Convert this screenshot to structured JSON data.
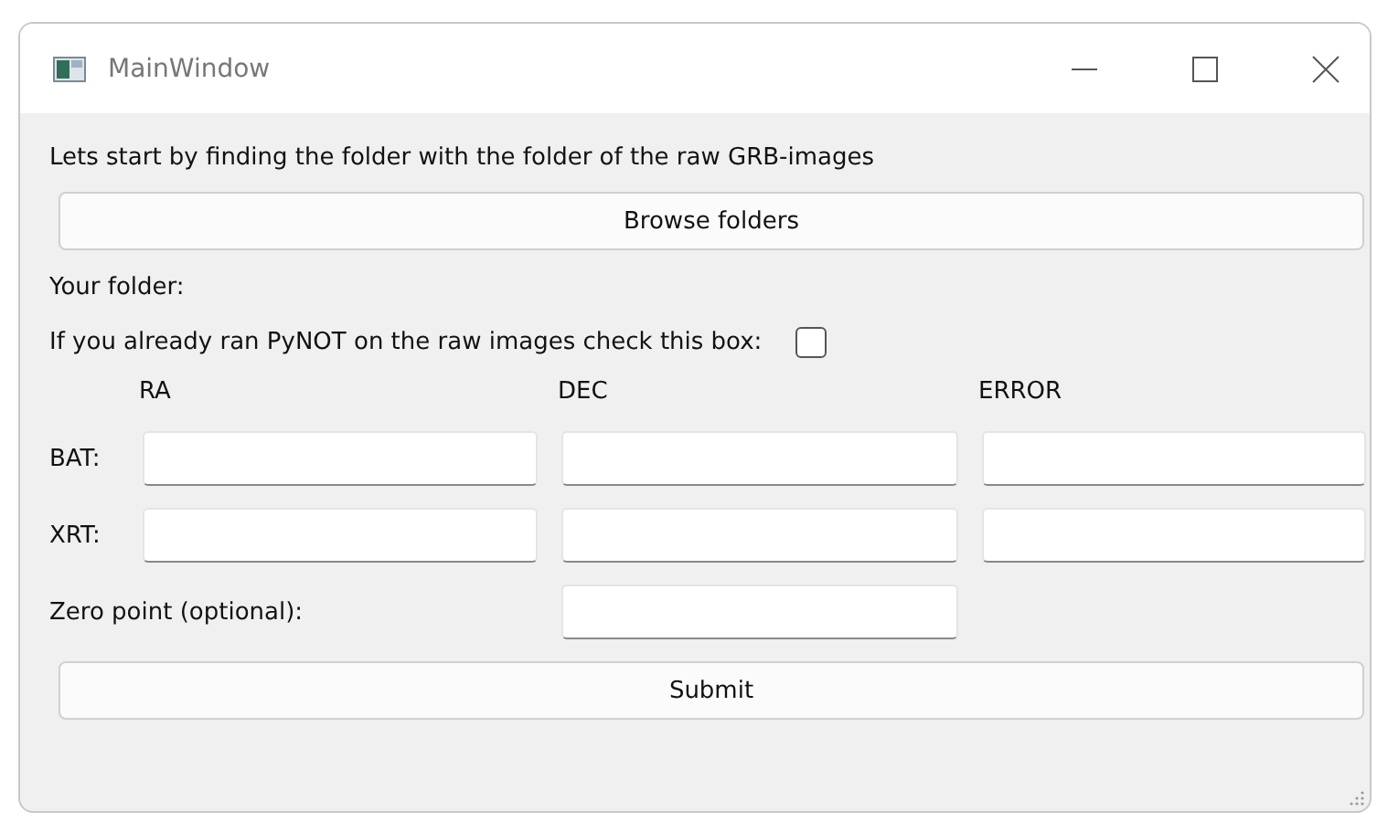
{
  "window": {
    "title": "MainWindow"
  },
  "intro": "Lets start by finding the folder with the folder of the raw GRB-images",
  "browse_button": "Browse folders",
  "folder_label": "Your folder:",
  "checkbox": {
    "label": "If you already ran PyNOT on the raw images check this box:",
    "checked": false
  },
  "columns": [
    "RA",
    "DEC",
    "ERROR"
  ],
  "rows": [
    {
      "label": "BAT:"
    },
    {
      "label": "XRT:"
    }
  ],
  "zero_point": {
    "label": "Zero point (optional):"
  },
  "submit_button": "Submit"
}
